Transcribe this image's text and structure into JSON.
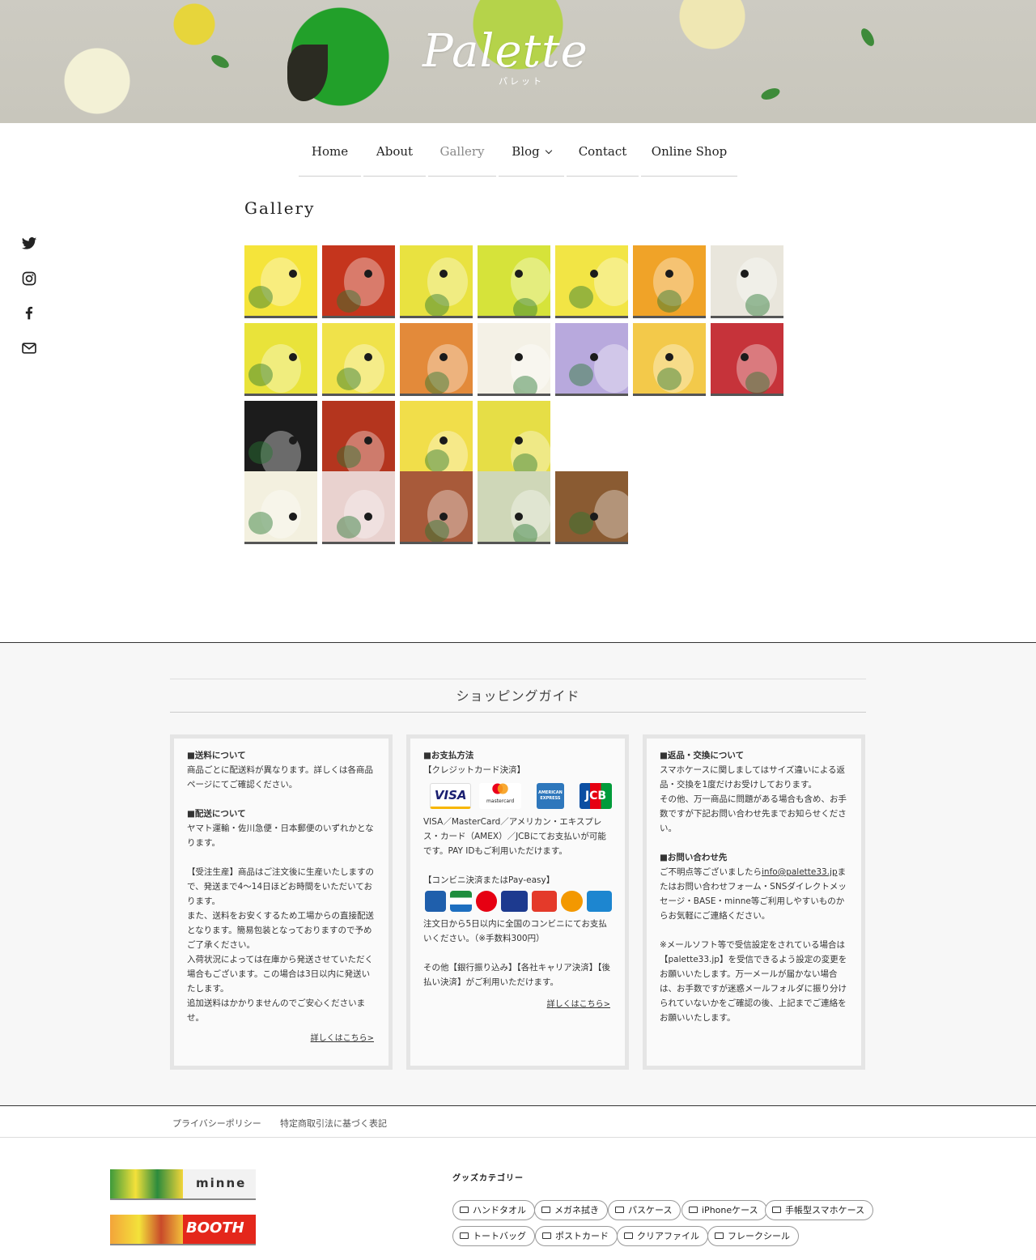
{
  "header": {
    "logo_text": "Palette",
    "logo_sub": "パレット"
  },
  "nav": {
    "items": [
      {
        "label": "Home"
      },
      {
        "label": "About"
      },
      {
        "label": "Gallery"
      },
      {
        "label": "Blog"
      },
      {
        "label": "Contact"
      },
      {
        "label": "Online Shop"
      }
    ]
  },
  "social": [
    "twitter-icon",
    "instagram-icon",
    "facebook-icon",
    "mail-icon"
  ],
  "page": {
    "title": "Gallery"
  },
  "gallery": {
    "rows": [
      [
        "#f5e43a",
        "#c5351d",
        "#e9e240",
        "#d6e33a",
        "#f2e545",
        "#f0a328",
        "#e9e6dc"
      ],
      [
        "#e9e33a",
        "#f0e24a",
        "#e38a3a",
        "#f4f1e6",
        "#b8a9dd",
        "#f3c94a",
        "#c6333a"
      ],
      [
        "#1c1c1c",
        "#b4351e",
        "#f1de4a",
        "#e6de46"
      ],
      [
        "#f3f0df",
        "#e9d2cf",
        "#a85a3a",
        "#cfd7b8",
        "#8a5b32"
      ]
    ]
  },
  "guide": {
    "title": "ショッピングガイド",
    "shipping": {
      "h1": "■送料について",
      "p1": "商品ごとに配送料が異なります。詳しくは各商品ページにてご確認ください。",
      "h2": "■配送について",
      "p2": "ヤマト運輸・佐川急便・日本郵便のいずれかとなります。",
      "p3": "【受注生産】商品はご注文後に生産いたしますので、発送まで4〜14日ほどお時間をいただいております。\nまた、送料をお安くするため工場からの直接配送となります。簡易包装となっておりますので予めご了承ください。\n入荷状況によっては在庫から発送させていただく場合もございます。この場合は3日以内に発送いたします。\n追加送料はかかりませんのでご安心くださいませ。",
      "more": "詳しくはこちら>"
    },
    "payment": {
      "h1": "■お支払方法",
      "sub1": "【クレジットカード決済】",
      "cards": [
        "VISA",
        "mastercard",
        "AMERICAN EXPRESS",
        "JCB"
      ],
      "p1": "VISA／MasterCard／アメリカン・エキスプレス・カード（AMEX）／JCBにてお支払いが可能です。PAY IDもご利用いただけます。",
      "sub2": "【コンビニ決済またはPay-easy】",
      "p2": "注文日から5日以内に全国のコンビニにてお支払いください。（※手数料300円）",
      "p3": "その他【銀行振り込み】【各社キャリア決済】【後払い決済】がご利用いただけます。",
      "more": "詳しくはこちら>"
    },
    "returns": {
      "h1": "■返品・交換について",
      "p1": "スマホケースに関しましてはサイズ違いによる返品・交換を1度だけお受けしております。\nその他、万一商品に問題がある場合も含め、お手数ですが下記お問い合わせ先までお知らせください。",
      "h2": "■お問い合わせ先",
      "p2a": "ご不明点等ございましたら",
      "email": "info@palette33.jp",
      "p2b": "またはお問い合わせフォーム・SNSダイレクトメッセージ・BASE・minne等ご利用しやすいものからお気軽にご連絡ください。",
      "p3": "※メールソフト等で受信設定をされている場合は【palette33.jp】を受信できるよう設定の変更をお願いいたします。万一メールが届かない場合は、お手数ですが迷惑メールフォルダに振り分けられていないかをご確認の後、上記までご連絡をお願いいたします。"
    }
  },
  "subfooter": {
    "privacy": "プライバシーポリシー",
    "tokushoho": "特定商取引法に基づく表記"
  },
  "banners": {
    "minne": "minne",
    "booth": "BOOTH"
  },
  "categories": {
    "title": "グッズカテゴリー",
    "tags": [
      "ハンドタオル",
      "メガネ拭き",
      "パスケース",
      "iPhoneケース",
      "手帳型スマホケース",
      "トートバッグ",
      "ポストカード",
      "クリアファイル",
      "フレークシール"
    ]
  }
}
